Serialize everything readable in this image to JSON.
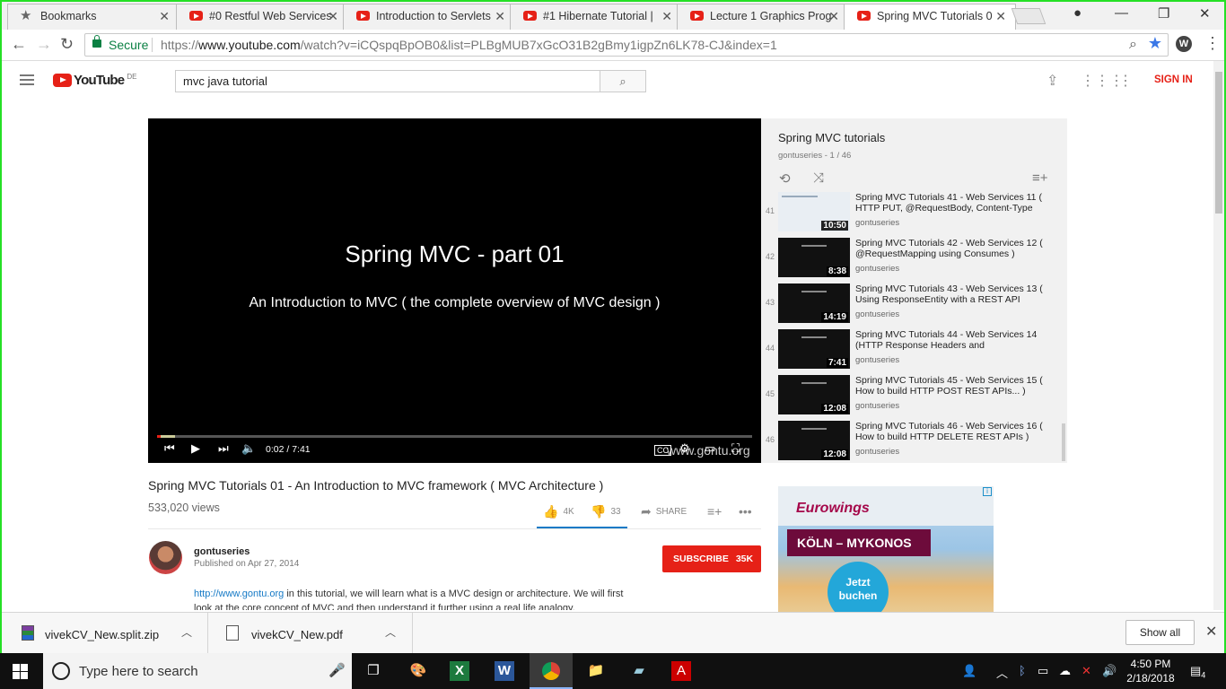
{
  "browser": {
    "tabs": [
      {
        "label": "Bookmarks",
        "icon": "star-icon",
        "active": false
      },
      {
        "label": "#0 Restful Web Services",
        "icon": "youtube-icon",
        "active": false
      },
      {
        "label": "Introduction to Servlets",
        "icon": "youtube-icon",
        "active": false
      },
      {
        "label": "#1 Hibernate Tutorial | ",
        "icon": "youtube-icon",
        "active": false
      },
      {
        "label": "Lecture 1 Graphics Prog",
        "icon": "youtube-icon",
        "active": false
      },
      {
        "label": "Spring MVC Tutorials 0",
        "icon": "youtube-icon",
        "active": true
      }
    ],
    "address": {
      "secure_label": "Secure",
      "url_scheme": "https://",
      "url_host": "www.youtube.com",
      "url_path": "/watch?v=iCQspqBpOB0&list=PLBgMUB7xGcO31B2gBmy1igpZn6LK78-CJ&index=1"
    },
    "extension_letter": "W"
  },
  "youtube": {
    "logo_text": "YouTube",
    "country": "DE",
    "search_query": "mvc java tutorial",
    "sign_in": "SIGN IN"
  },
  "player": {
    "slide_title": "Spring MVC - part 01",
    "slide_subtitle": "An Introduction to MVC ( the complete overview of MVC design )",
    "time": "0:02 / 7:41",
    "progress_fraction": 0.004,
    "buffer_fraction": 0.03,
    "watermark": "www.gontu.org",
    "cc_label": "CC"
  },
  "playlist": {
    "title": "Spring MVC tutorials",
    "subtitle": "gontuseries - 1 / 46",
    "items": [
      {
        "index": "41",
        "title": "Spring MVC Tutorials 41 - Web Services 11 ( HTTP PUT, @RequestBody, Content-Type",
        "owner": "gontuseries",
        "duration": "10:50",
        "light": true
      },
      {
        "index": "42",
        "title": "Spring MVC Tutorials 42 - Web Services 12 ( @RequestMapping using Consumes )",
        "owner": "gontuseries",
        "duration": "8:38",
        "light": false
      },
      {
        "index": "43",
        "title": "Spring MVC Tutorials 43 - Web Services 13 ( Using ResponseEntity with a REST API",
        "owner": "gontuseries",
        "duration": "14:19",
        "light": false
      },
      {
        "index": "44",
        "title": "Spring MVC Tutorials 44 - Web Services 14 (HTTP Response Headers and",
        "owner": "gontuseries",
        "duration": "7:41",
        "light": false
      },
      {
        "index": "45",
        "title": "Spring MVC Tutorials 45 - Web Services 15 ( How to build HTTP POST REST APIs... )",
        "owner": "gontuseries",
        "duration": "12:08",
        "light": false
      },
      {
        "index": "46",
        "title": "Spring MVC Tutorials 46 - Web Services 16 ( How to build HTTP DELETE REST APIs )",
        "owner": "gontuseries",
        "duration": "12:08",
        "light": false
      }
    ]
  },
  "video": {
    "title": "Spring MVC Tutorials 01 - An Introduction to MVC framework ( MVC Architecture )",
    "views": "533,020 views",
    "likes": "4K",
    "dislikes": "33",
    "share_label": "SHARE",
    "channel": "gontuseries",
    "published": "Published on Apr 27, 2014",
    "subscribe_label": "SUBSCRIBE",
    "subscriber_count": "35K",
    "description_link": "http://www.gontu.org",
    "description_text": " in this tutorial, we will learn what is a MVC design or architecture. We will first look at the core concept of MVC and then understand it further using a real life analogy."
  },
  "ad": {
    "brand": "Eurowings",
    "headline": "KÖLN – MYKONOS",
    "cta_line1": "Jetzt",
    "cta_line2": "buchen"
  },
  "downloads": {
    "items": [
      {
        "name": "vivekCV_New.split.zip"
      },
      {
        "name": "vivekCV_New.pdf"
      }
    ],
    "show_all": "Show all"
  },
  "taskbar": {
    "search_placeholder": "Type here to search",
    "time": "4:50 PM",
    "date": "2/18/2018",
    "notification_count": "4"
  },
  "colors": {
    "youtube_red": "#e62117",
    "secure_green": "#0b8043",
    "link_blue": "#167ac6",
    "star_blue": "#3b78e7"
  }
}
